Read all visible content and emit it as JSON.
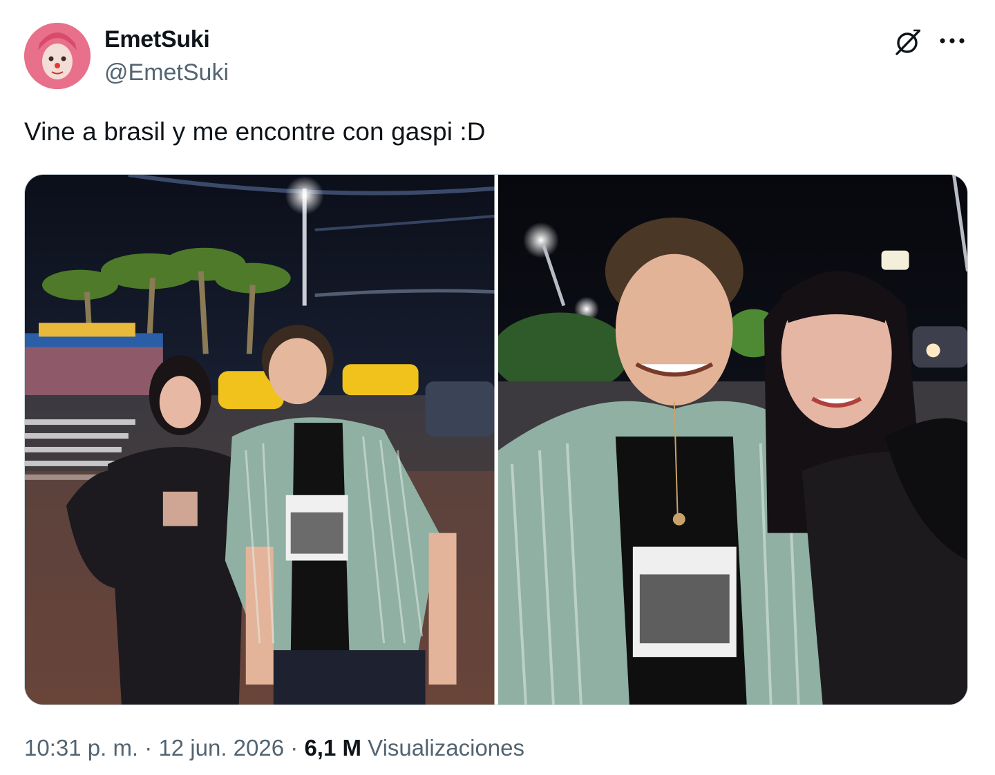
{
  "author": {
    "name": "EmetSuki",
    "handle": "@EmetSuki",
    "avatar_icon": "user-avatar"
  },
  "actions": {
    "grok_icon": "grok-icon",
    "more_icon": "more-horizontal-icon"
  },
  "tweet": {
    "text": "Vine a brasil y me encontre con gaspi :D"
  },
  "media": [
    {
      "kind": "photo",
      "alt": ""
    },
    {
      "kind": "photo",
      "alt": ""
    }
  ],
  "footer": {
    "time": "10:31 p. m.",
    "sep1": " · ",
    "date": "12 jun. 2026",
    "sep2": " · ",
    "views_count": "6,1 M",
    "views_label": " Visualizaciones"
  },
  "colors": {
    "text_primary": "#0f1419",
    "text_secondary": "#536471",
    "border": "#cfd9de"
  }
}
